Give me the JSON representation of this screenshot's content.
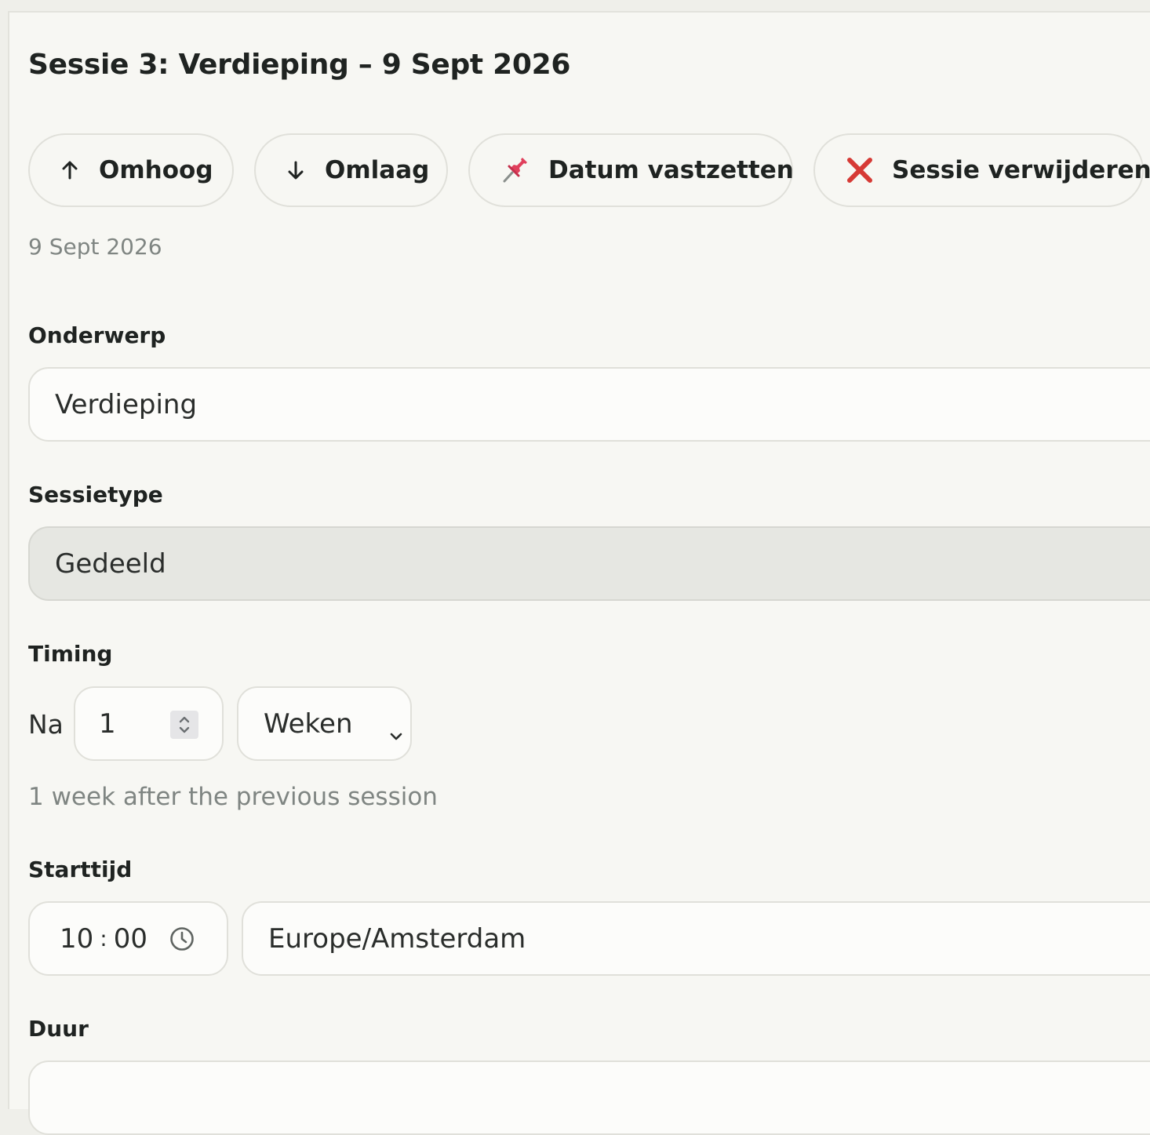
{
  "session": {
    "title": "Sessie 3: Verdieping – 9 Sept 2026",
    "date_display": "9 Sept 2026"
  },
  "actions": {
    "up_label": "Omhoog",
    "down_label": "Omlaag",
    "pin_label": "Datum vastzetten",
    "delete_label": "Sessie verwijderen"
  },
  "form": {
    "subject": {
      "label": "Onderwerp",
      "value": "Verdieping"
    },
    "session_type": {
      "label": "Sessietype",
      "value": "Gedeeld"
    },
    "timing": {
      "label": "Timing",
      "prefix": "Na",
      "amount": "1",
      "unit": "Weken",
      "hint": "1 week after the previous session"
    },
    "start_time": {
      "label": "Starttijd",
      "hours": "10",
      "separator": ":",
      "minutes": "00",
      "timezone": "Europe/Amsterdam"
    },
    "duration": {
      "label": "Duur"
    }
  },
  "colors": {
    "delete_icon": "#d63a35",
    "pin_icon": "#e0405c",
    "panel_bg": "#f7f7f3",
    "field_bg": "#fcfcfa",
    "disabled_field_bg": "#e6e7e2",
    "muted_text": "#7f8582"
  },
  "icons": {
    "up": "arrow-up-icon",
    "down": "arrow-down-icon",
    "pin": "pushpin-icon",
    "delete": "close-x-icon",
    "select": "chevron-down-icon",
    "stepper": "spin-stepper-icon",
    "time": "clock-icon"
  }
}
